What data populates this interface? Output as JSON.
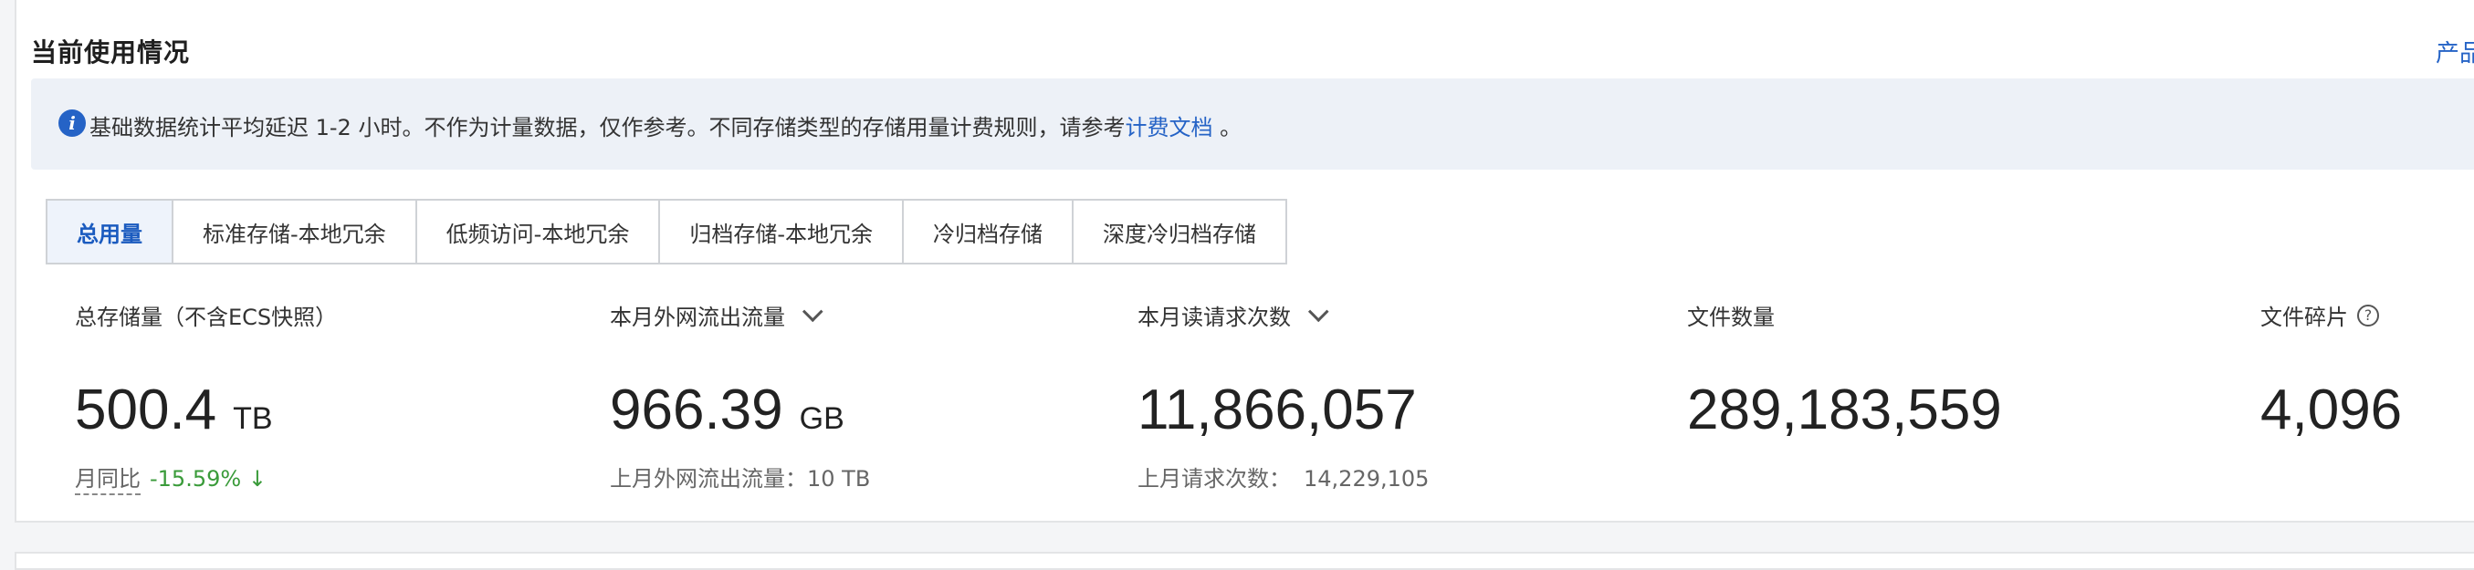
{
  "header": {
    "title": "当前使用情况",
    "product_link": "产品"
  },
  "info": {
    "text": "基础数据统计平均延迟 1-2 小时。不作为计量数据，仅作参考。不同存储类型的存储用量计费规则，请参考",
    "link": "计费文档",
    "suffix": " 。"
  },
  "tabs": [
    "总用量",
    "标准存储-本地冗余",
    "低频访问-本地冗余",
    "归档存储-本地冗余",
    "冷归档存储",
    "深度冷归档存储"
  ],
  "metrics": {
    "storage": {
      "label": "总存储量（不含ECS快照）",
      "value": "500.4",
      "unit": "TB",
      "compare_label": "月同比",
      "compare_value": "-15.59%"
    },
    "traffic": {
      "label": "本月外网流出流量",
      "value": "966.39",
      "unit": "GB",
      "sub": "上月外网流出流量：10 TB"
    },
    "requests": {
      "label": "本月读请求次数",
      "value": "11,866,057",
      "sub_label": "上月请求次数：",
      "sub_value": "14,229,105"
    },
    "files": {
      "label": "文件数量",
      "value": "289,183,559"
    },
    "fragments": {
      "label": "文件碎片",
      "value": "4,096"
    }
  }
}
